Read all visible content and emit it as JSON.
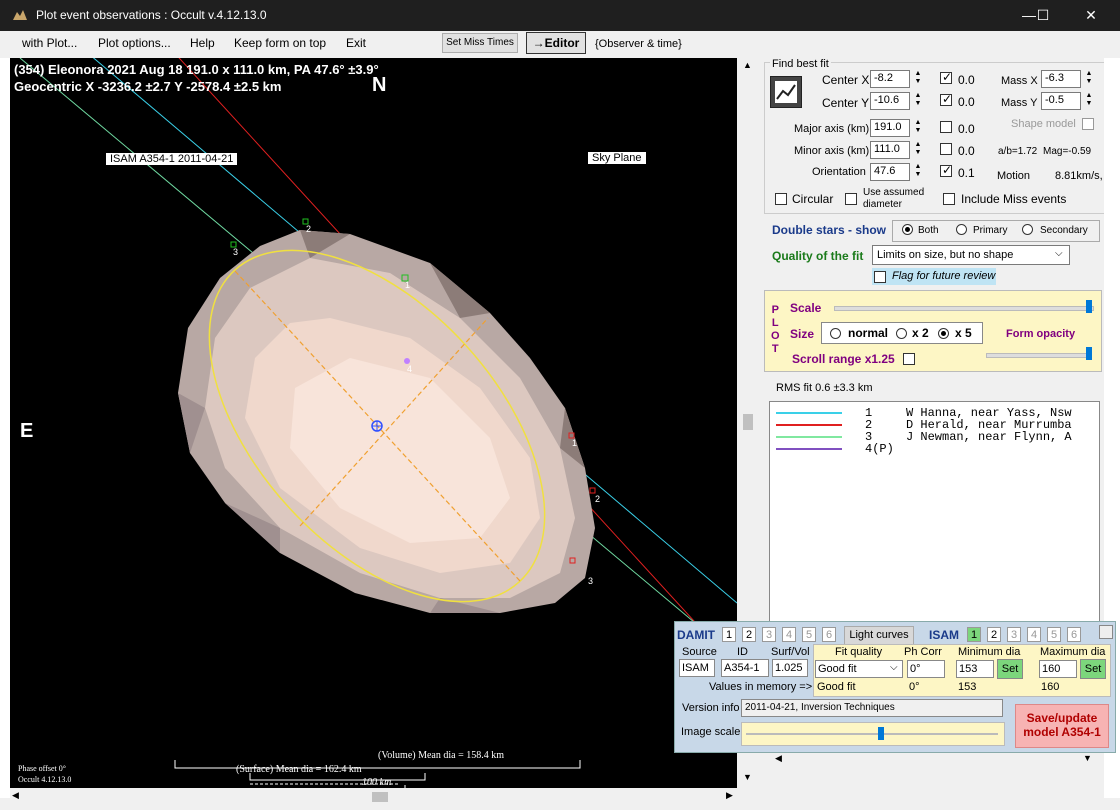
{
  "window": {
    "title": "Plot event observations : Occult v.4.12.13.0",
    "minimize": "—",
    "maximize": "☐",
    "close": "✕"
  },
  "menu": {
    "items": [
      "with Plot...",
      "Plot options...",
      "Help",
      "Keep form on top",
      "Exit"
    ],
    "set_miss_times": "Set Miss Times",
    "editor": "→Editor",
    "observer_time": "{Observer & time}"
  },
  "plot": {
    "header_line1": "(354) Eleonora  2021 Aug 18   191.0 x 111.0 km, PA 47.6° ±3.9°",
    "header_line2": "Geocentric  X  -3236.2 ±2.7  Y -2578.4 ±2.5 km",
    "north": "N",
    "east": "E",
    "model_label": "ISAM A354-1 2011-04-21",
    "sky_plane": "Sky Plane",
    "chord_nums": [
      "1",
      "2",
      "3",
      "4",
      "1",
      "2",
      "3"
    ],
    "phase_offset": "Phase offset 0°",
    "version": "Occult 4.12.13.0",
    "volume_dia": "(Volume) Mean dia = 158.4 km",
    "surface_dia": "(Surface) Mean dia = 162.4 km",
    "scale_label": "100 km"
  },
  "fit": {
    "group_title": "Find best fit",
    "center_x_label": "Center X",
    "center_x": "-8.2",
    "center_x_check": "0.0",
    "center_y_label": "Center Y",
    "center_y": "-10.6",
    "center_y_check": "0.0",
    "mass_x_label": "Mass X",
    "mass_x": "-6.3",
    "mass_y_label": "Mass Y",
    "mass_y": "-0.5",
    "major_label": "Major axis (km)",
    "major": "191.0",
    "major_check": "0.0",
    "minor_label": "Minor axis (km)",
    "minor": "111.0",
    "minor_check": "0.0",
    "orient_label": "Orientation",
    "orient": "47.6",
    "orient_check": "0.1",
    "shape_model": "Shape model",
    "ab_ratio": "a/b=1.72",
    "mag": "Mag=-0.59",
    "motion_label": "Motion",
    "motion": "8.81km/s,",
    "circular": "Circular",
    "use_assumed": "Use assumed",
    "diameter": "diameter",
    "include_miss": "Include Miss events"
  },
  "double_stars": {
    "label": "Double stars - show",
    "both": "Both",
    "primary": "Primary",
    "secondary": "Secondary"
  },
  "quality": {
    "label": "Quality of the fit",
    "value": "Limits on size, but no shape",
    "flag": "Flag for future review"
  },
  "plot_panel": {
    "side_letters": [
      "P",
      "L",
      "O",
      "T"
    ],
    "scale": "Scale",
    "size": "Size",
    "normal": "normal",
    "x2": "x 2",
    "x5": "x 5",
    "form_opacity": "Form opacity",
    "scroll_range": "Scroll range x1.25"
  },
  "rms": "RMS fit 0.6 ±3.3 km",
  "observers": [
    {
      "num": "1",
      "name": "W Hanna, near Yass, Nsw",
      "color": "#3ad0e8"
    },
    {
      "num": "2",
      "name": "D Herald, near Murrumba",
      "color": "#e02020"
    },
    {
      "num": "3",
      "name": "J Newman, near Flynn, A",
      "color": "#80e8a0"
    },
    {
      "num": "4(P)",
      "name": "",
      "color": "#8050c0"
    }
  ],
  "damit": {
    "damit_label": "DAMIT",
    "damit_tabs": [
      "1",
      "2",
      "3",
      "4",
      "5",
      "6"
    ],
    "light_curves": "Light curves",
    "isam_label": "ISAM",
    "isam_tabs": [
      "1",
      "2",
      "3",
      "4",
      "5",
      "6"
    ],
    "source_h": "Source",
    "id_h": "ID",
    "surf_h": "Surf/Vol",
    "fitq_h": "Fit quality",
    "phcorr_h": "Ph Corr",
    "mindia_h": "Minimum dia",
    "maxdia_h": "Maximum dia",
    "source": "ISAM",
    "id": "A354-1",
    "surf": "1.025",
    "fitq": "Good fit",
    "phcorr": "0°",
    "mindia": "153",
    "maxdia": "160",
    "set": "Set",
    "values_mem": "Values in memory =>",
    "mem_fitq": "Good fit",
    "mem_ph": "0°",
    "mem_min": "153",
    "mem_max": "160",
    "version_label": "Version info",
    "version_value": "2011-04-21, Inversion Techniques",
    "image_scale": "Image scale",
    "save_line1": "Save/update",
    "save_line2": "model A354-1"
  },
  "colors": {
    "ellipse": "#f0e040",
    "body": "#f6dcd0",
    "center": "#3050ff",
    "axis": "#f0a030"
  }
}
